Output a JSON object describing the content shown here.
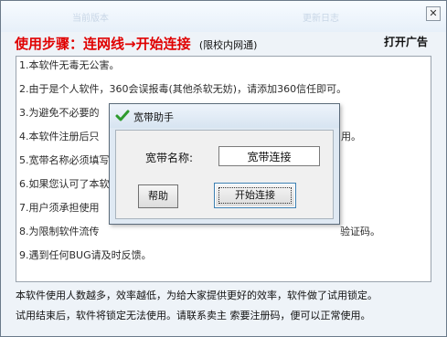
{
  "window": {
    "ghost_left": "当前版本",
    "ghost_right": "更新日志",
    "close_glyph": "✕"
  },
  "header": {
    "steps_text": "使用步骤：连网线→开始连接",
    "steps_note": "(限校内网通)",
    "ad_link": "打开广告"
  },
  "notes": [
    "1.本软件无毒无公害。",
    "2.由于是个人软件，360会误报毒(其他杀软无妨)，请添加360信任即可。",
    "3.为避免不必要的",
    "4.本软件注册后只",
    "5.宽带名称必须填写",
    "6.如果您认可了本软",
    "7.用户须承担使用",
    "8.为限制软件流传",
    "9.遇到任何BUG请及时反馈。"
  ],
  "notes_tail": {
    "line4": "用。",
    "line8": "验证码。"
  },
  "footer": {
    "line1": "本软件使用人数越多，效率越低，为给大家提供更好的效率，软件做了试用锁定。",
    "line2": "试用结束后，软件将锁定无法使用。请联系卖主 索要注册码，便可以正常使用。"
  },
  "dialog": {
    "title": "宽带助手",
    "field_label": "宽带名称:",
    "field_value": "宽带连接",
    "help_button": "帮助",
    "connect_button": "开始连接",
    "check_color": "#2e9b2e"
  }
}
